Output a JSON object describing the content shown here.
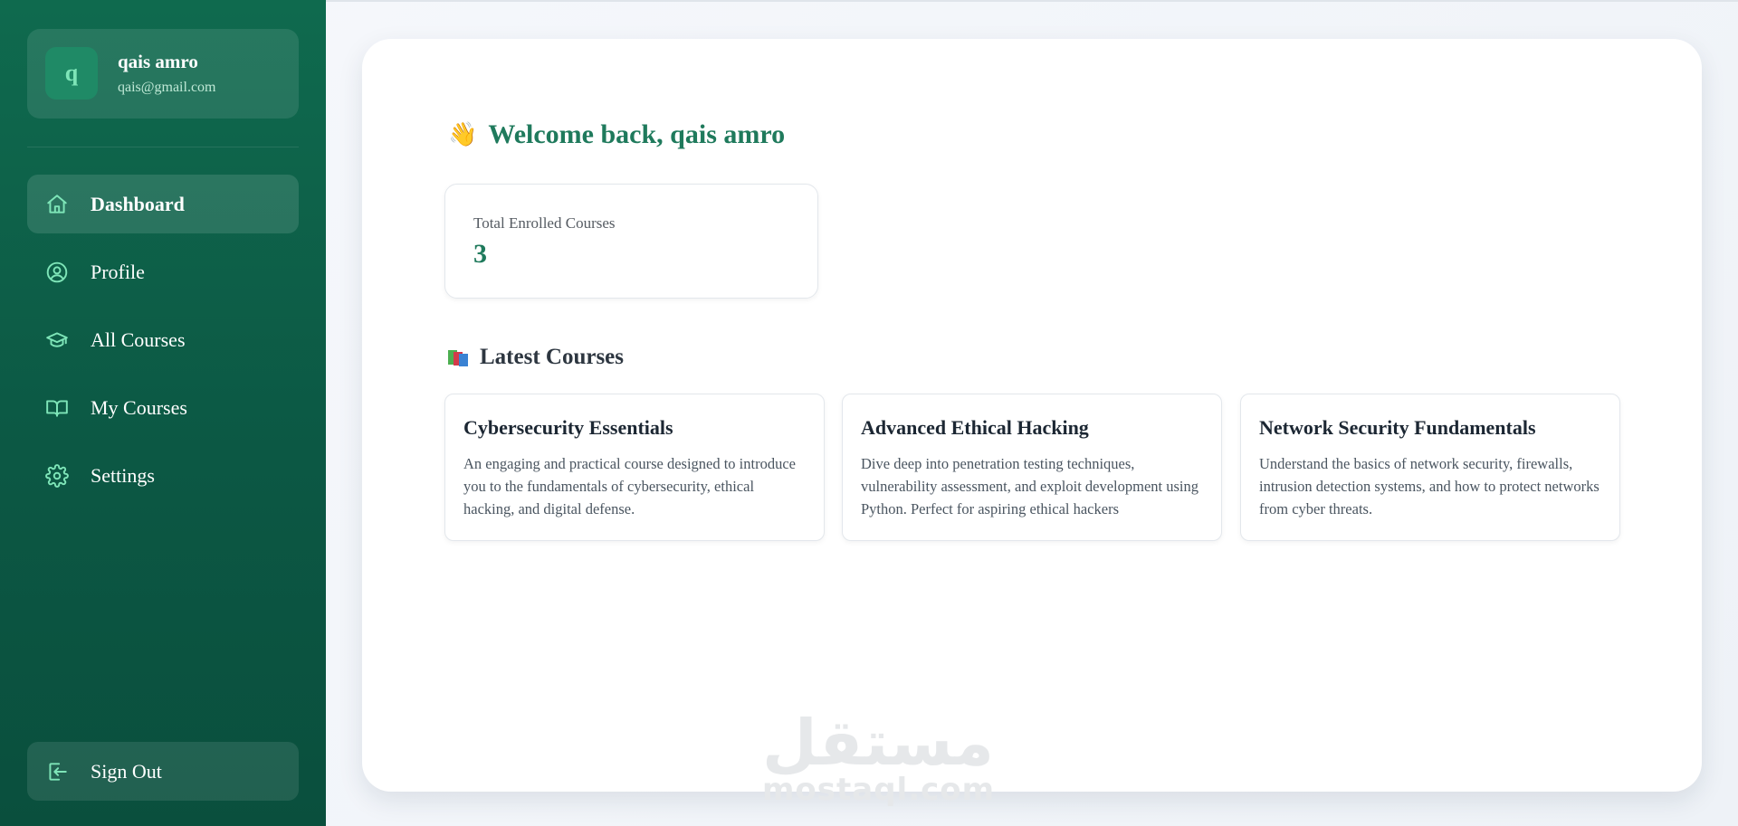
{
  "user": {
    "initial": "q",
    "name": "qais amro",
    "email": "qais@gmail.com"
  },
  "nav": {
    "items": [
      {
        "label": "Dashboard",
        "icon": "home-icon",
        "active": true
      },
      {
        "label": "Profile",
        "icon": "user-circle-icon",
        "active": false
      },
      {
        "label": "All Courses",
        "icon": "graduation-cap-icon",
        "active": false
      },
      {
        "label": "My Courses",
        "icon": "book-open-icon",
        "active": false
      },
      {
        "label": "Settings",
        "icon": "gear-icon",
        "active": false
      }
    ],
    "signout_label": "Sign Out",
    "signout_icon": "sign-out-icon"
  },
  "welcome": {
    "emoji": "👋",
    "text": "Welcome back, qais amro"
  },
  "stats": {
    "label": "Total Enrolled Courses",
    "value": "3"
  },
  "latest": {
    "title": "Latest Courses",
    "icon": "books-icon",
    "courses": [
      {
        "title": "Cybersecurity Essentials",
        "description": "An engaging and practical course designed to introduce you to the fundamentals of cybersecurity, ethical hacking, and digital defense."
      },
      {
        "title": "Advanced Ethical Hacking",
        "description": "Dive deep into penetration testing techniques, vulnerability assessment, and exploit development using Python. Perfect for aspiring ethical hackers"
      },
      {
        "title": "Network Security Fundamentals",
        "description": "Understand the basics of network security, firewalls, intrusion detection systems, and how to protect networks from cyber threats."
      }
    ]
  },
  "watermark": {
    "arabic": "مستقل",
    "latin": "mostaql.com"
  },
  "colors": {
    "sidebar": "#0f6a4e",
    "accent": "#1f7a5c",
    "icon": "#7ee5b8"
  }
}
